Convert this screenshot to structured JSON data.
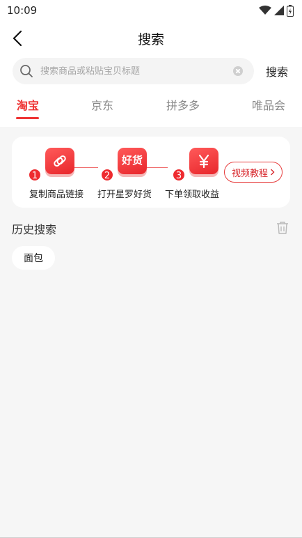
{
  "status": {
    "time": "10:09"
  },
  "header": {
    "title": "搜索"
  },
  "search": {
    "placeholder": "搜索商品或粘贴宝贝标题",
    "value": "",
    "button_label": "搜索"
  },
  "tabs": [
    {
      "label": "淘宝",
      "active": true
    },
    {
      "label": "京东",
      "active": false
    },
    {
      "label": "拼多多",
      "active": false
    },
    {
      "label": "唯品会",
      "active": false
    }
  ],
  "steps": [
    {
      "number": "1",
      "label": "复制商品链接",
      "icon": "link-icon"
    },
    {
      "number": "2",
      "label": "打开星罗好货",
      "icon": "app-logo-icon",
      "tile_text": "好货"
    },
    {
      "number": "3",
      "label": "下单领取收益",
      "icon": "yuan-icon"
    }
  ],
  "video_button": {
    "label": "视频教程"
  },
  "history": {
    "title": "历史搜索",
    "items": [
      "面包"
    ]
  },
  "colors": {
    "accent": "#e33333",
    "background": "#f6f6f6"
  }
}
